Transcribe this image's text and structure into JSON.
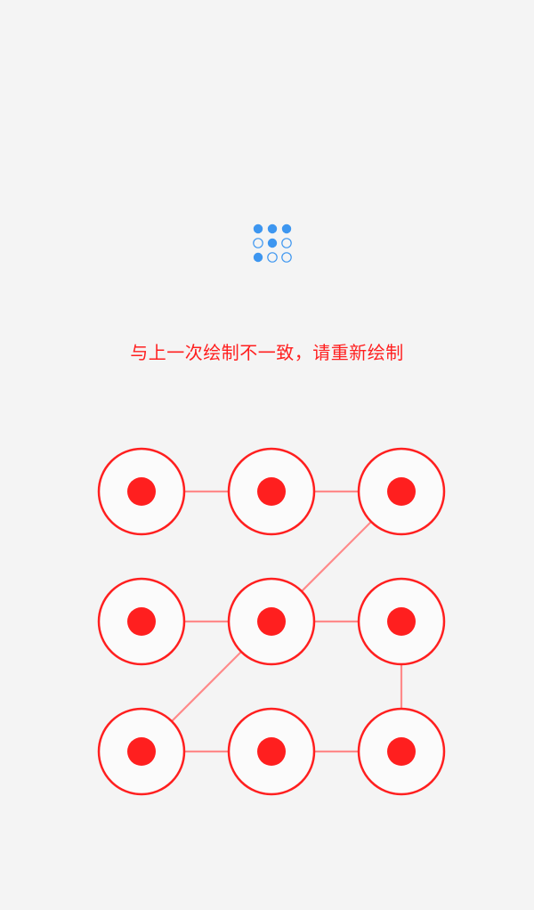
{
  "colors": {
    "background": "#f4f4f4",
    "error_red": "#ff1f1f",
    "error_red_light": "#ff8a8a",
    "preview_blue": "#3d96f0",
    "node_fill": "#fbfbfb"
  },
  "preview": {
    "icon": "pattern-preview-icon",
    "dots": [
      {
        "row": 1,
        "col": 1,
        "filled": true
      },
      {
        "row": 1,
        "col": 2,
        "filled": true
      },
      {
        "row": 1,
        "col": 3,
        "filled": true
      },
      {
        "row": 2,
        "col": 1,
        "filled": false
      },
      {
        "row": 2,
        "col": 2,
        "filled": true
      },
      {
        "row": 2,
        "col": 3,
        "filled": false
      },
      {
        "row": 3,
        "col": 1,
        "filled": true
      },
      {
        "row": 3,
        "col": 2,
        "filled": false
      },
      {
        "row": 3,
        "col": 3,
        "filled": false
      }
    ]
  },
  "message": {
    "text": "与上一次绘制不一致，请重新绘制"
  },
  "pattern": {
    "nodes": [
      {
        "id": 1,
        "row": 1,
        "col": 1,
        "selected": true
      },
      {
        "id": 2,
        "row": 1,
        "col": 2,
        "selected": true
      },
      {
        "id": 3,
        "row": 1,
        "col": 3,
        "selected": true
      },
      {
        "id": 4,
        "row": 2,
        "col": 1,
        "selected": true
      },
      {
        "id": 5,
        "row": 2,
        "col": 2,
        "selected": true
      },
      {
        "id": 6,
        "row": 2,
        "col": 3,
        "selected": true
      },
      {
        "id": 7,
        "row": 3,
        "col": 1,
        "selected": true
      },
      {
        "id": 8,
        "row": 3,
        "col": 2,
        "selected": true
      },
      {
        "id": 9,
        "row": 3,
        "col": 3,
        "selected": true
      }
    ],
    "connections": [
      [
        1,
        2
      ],
      [
        2,
        3
      ],
      [
        3,
        5
      ],
      [
        4,
        5
      ],
      [
        5,
        6
      ],
      [
        5,
        7
      ],
      [
        6,
        9
      ],
      [
        7,
        8
      ],
      [
        8,
        9
      ]
    ]
  }
}
